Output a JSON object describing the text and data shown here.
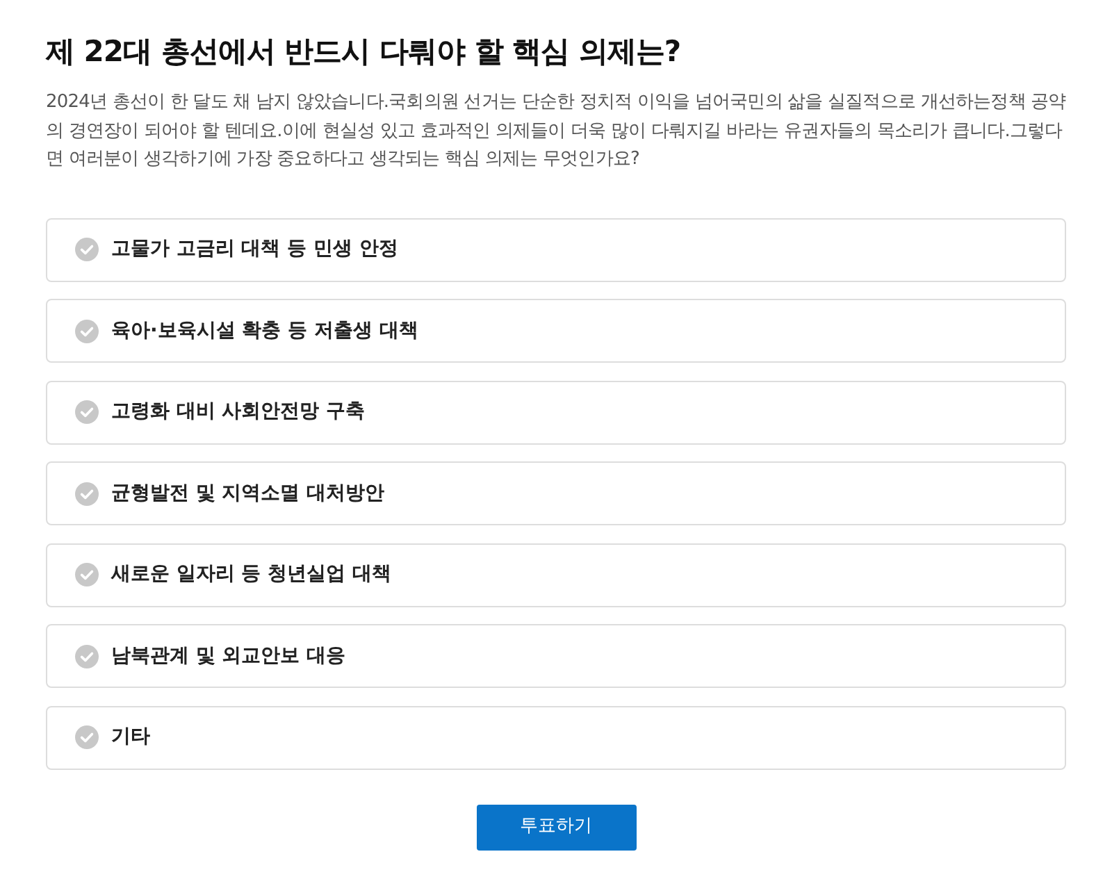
{
  "title": "제 22대 총선에서 반드시 다뤄야 할 핵심 의제는?",
  "description": "2024년 총선이 한 달도 채 남지 않았습니다.국회의원 선거는 단순한 정치적 이익을 넘어국민의 삶을 실질적으로 개선하는정책 공약의 경연장이 되어야 할 텐데요.이에 현실성 있고 효과적인 의제들이 더욱 많이 다뤄지길 바라는 유권자들의 목소리가 큽니다.그렇다면 여러분이 생각하기에 가장 중요하다고 생각되는 핵심 의제는 무엇인가요?",
  "options": [
    {
      "label": "고물가 고금리 대책 등 민생 안정",
      "selected": false
    },
    {
      "label": "육아·보육시설 확충 등 저출생 대책",
      "selected": false
    },
    {
      "label": "고령화 대비 사회안전망 구축",
      "selected": false
    },
    {
      "label": "균형발전 및 지역소멸 대처방안",
      "selected": false
    },
    {
      "label": "새로운 일자리 등 청년실업 대책",
      "selected": false
    },
    {
      "label": "남북관계 및 외교안보 대응",
      "selected": false
    },
    {
      "label": "기타",
      "selected": false
    }
  ],
  "submit_button": "투표하기"
}
